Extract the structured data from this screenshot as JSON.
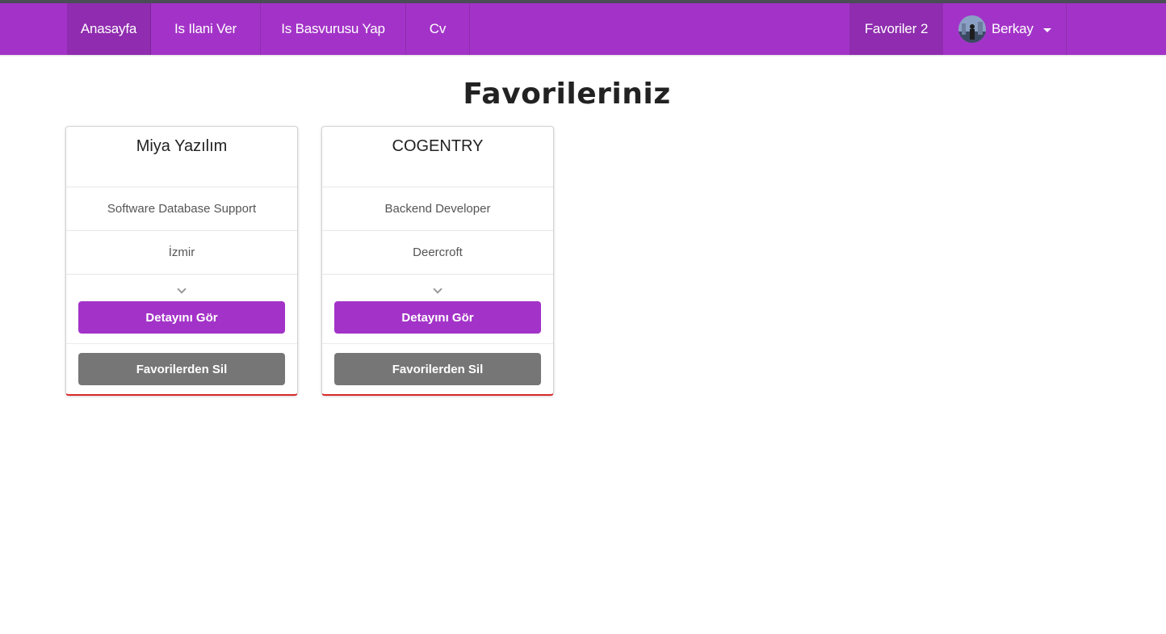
{
  "navbar": {
    "home": "Anasayfa",
    "post_job": "Is Ilani Ver",
    "apply_job": "Is Basvurusu Yap",
    "cv": "Cv",
    "favorites_label": "Favoriler",
    "favorites_count": "2",
    "user_name": "Berkay"
  },
  "page": {
    "title": "Favorileriniz"
  },
  "favorites": [
    {
      "company": "Miya Yazılım",
      "position": "Software Database Support",
      "city": "İzmir",
      "detail_label": "Detayını Gör",
      "remove_label": "Favorilerden Sil"
    },
    {
      "company": "COGENTRY",
      "position": "Backend Developer",
      "city": "Deercroft",
      "detail_label": "Detayını Gör",
      "remove_label": "Favorilerden Sil"
    }
  ],
  "colors": {
    "primary": "#a333c8",
    "secondary": "#767676",
    "card_accent": "#db2828"
  }
}
